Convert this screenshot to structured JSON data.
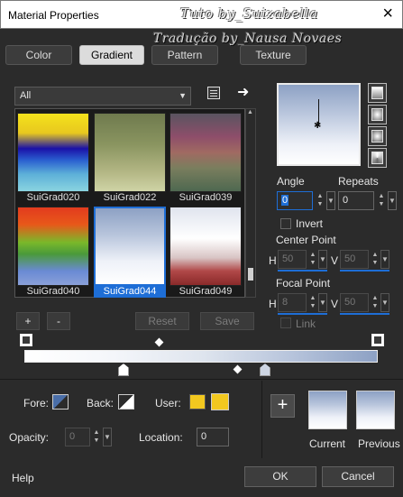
{
  "window": {
    "title": "Material Properties",
    "close_symbol": "×"
  },
  "watermark": {
    "line1": "Tuto by_Suizabella",
    "line2": "Tradução by_Nausa Novaes"
  },
  "tabs": [
    {
      "label": "Color",
      "active": false
    },
    {
      "label": "Gradient",
      "active": true
    },
    {
      "label": "Pattern",
      "active": false
    },
    {
      "label": "Texture",
      "active": false
    }
  ],
  "category": {
    "selected": "All"
  },
  "gradients": [
    {
      "name": "SuiGrad020",
      "selected": false
    },
    {
      "name": "SuiGrad022",
      "selected": false
    },
    {
      "name": "SuiGrad039",
      "selected": false
    },
    {
      "name": "SuiGrad040",
      "selected": false
    },
    {
      "name": "SuiGrad044",
      "selected": true
    },
    {
      "name": "SuiGrad049",
      "selected": false
    }
  ],
  "grid_buttons": {
    "add": "+",
    "remove": "-",
    "reset": "Reset",
    "save": "Save"
  },
  "angle": {
    "label": "Angle",
    "value": "0"
  },
  "repeats": {
    "label": "Repeats",
    "value": "0"
  },
  "invert": {
    "label": "Invert",
    "checked": false
  },
  "center_point": {
    "label": "Center Point",
    "h_label": "H",
    "h_value": "50",
    "v_label": "V",
    "v_value": "50"
  },
  "focal_point": {
    "label": "Focal Point",
    "h_label": "H",
    "h_value": "8",
    "v_label": "V",
    "v_value": "50"
  },
  "link": {
    "label": "Link",
    "checked": false
  },
  "bottom": {
    "fore_label": "Fore:",
    "back_label": "Back:",
    "user_label": "User:",
    "opacity_label": "Opacity:",
    "opacity_value": "0",
    "location_label": "Location:",
    "location_value": "0",
    "current_label": "Current",
    "previous_label": "Previous",
    "add_symbol": "+"
  },
  "footer": {
    "help": "Help",
    "ok": "OK",
    "cancel": "Cancel"
  },
  "colors": {
    "accent": "#1e6ed6",
    "gradient_light": "#ffffff",
    "gradient_dark": "#8da1c4",
    "user_color": "#f2c81f"
  }
}
